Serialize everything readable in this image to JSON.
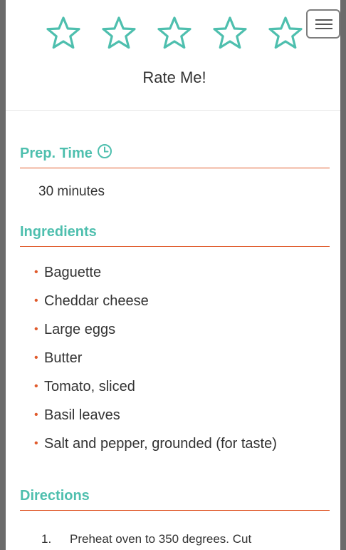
{
  "rating": {
    "stars_total": 5,
    "stars_filled": 0,
    "star_color": "#4ebfae",
    "label": "Rate Me!"
  },
  "menu": {
    "icon": "hamburger-menu-icon"
  },
  "prep": {
    "heading": "Prep. Time",
    "icon": "clock-icon",
    "value": "30 minutes"
  },
  "ingredients": {
    "heading": "Ingredients",
    "bullet": "•",
    "items": [
      "Baguette",
      "Cheddar cheese",
      "Large eggs",
      "Butter",
      "Tomato, sliced",
      "Basil leaves",
      "Salt and pepper, grounded (for taste)"
    ]
  },
  "directions": {
    "heading": "Directions",
    "steps": [
      {
        "number": "1.",
        "text": "Preheat oven to 350 degrees. Cut"
      }
    ]
  },
  "colors": {
    "accent": "#4ebfae",
    "divider": "#e05a2b",
    "text": "#333333"
  }
}
